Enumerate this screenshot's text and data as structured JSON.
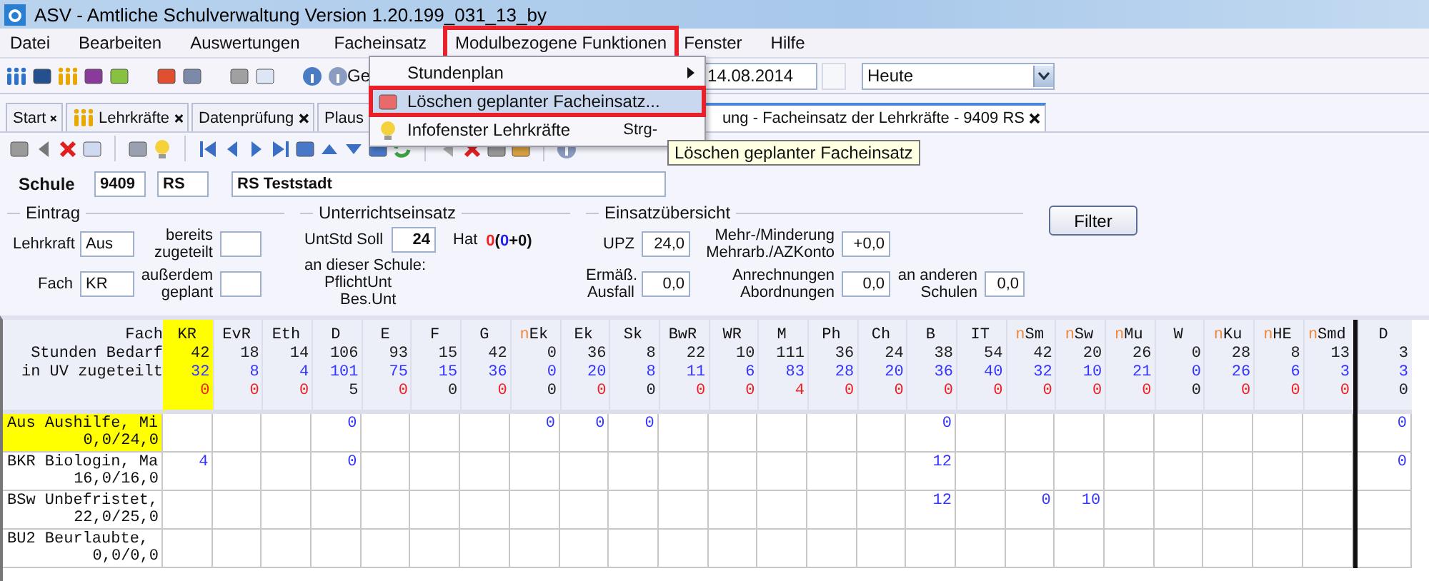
{
  "window": {
    "title": "ASV - Amtliche Schulverwaltung Version 1.20.199_031_13_by"
  },
  "menu_bar": [
    {
      "label": "Datei",
      "annotated": false
    },
    {
      "label": "Bearbeiten",
      "annotated": false
    },
    {
      "label": "Auswertungen",
      "annotated": false
    },
    {
      "label": "Facheinsatz",
      "annotated": false
    },
    {
      "label": "Modulbezogene Funktionen",
      "annotated": true
    },
    {
      "label": "Fenster",
      "annotated": false
    },
    {
      "label": "Hilfe",
      "annotated": false
    }
  ],
  "menu_dropdown": {
    "items": [
      {
        "label": "Stundenplan",
        "kind": "submenu",
        "selected": false,
        "annotated": false
      },
      {
        "label": "Löschen geplanter Facheinsatz...",
        "kind": "command",
        "selected": true,
        "annotated": true
      },
      {
        "label": "Infofenster Lehrkräfte",
        "kind": "command",
        "shortcut": "Strg-",
        "selected": false,
        "annotated": false
      }
    ]
  },
  "tooltip": "Löschen geplanter Facheinsatz",
  "toolbar": {
    "label": "Ge",
    "date": "14.08.2014",
    "period": "Heute"
  },
  "tabs": [
    {
      "label": "Start",
      "icon": false,
      "closable": true,
      "selected": false
    },
    {
      "label": "Lehrkräfte",
      "icon": true,
      "closable": true,
      "selected": false
    },
    {
      "label": "Datenprüfung",
      "icon": false,
      "closable": true,
      "selected": false
    },
    {
      "label": "Plaus",
      "icon": false,
      "selected": false
    },
    {
      "label": "ung - Facheinsatz der Lehrkräfte - 9409 RS",
      "icon": false,
      "closable": true,
      "selected": true
    }
  ],
  "school": {
    "label": "Schule",
    "number": "9409",
    "type": "RS",
    "name": "RS Teststadt"
  },
  "entry": {
    "title": "Eintrag",
    "teacher_label": "Lehrkraft",
    "teacher": "Aus",
    "subject_label": "Fach",
    "subject": "KR",
    "assigned_label": "bereits zugeteilt",
    "planned_label": "außerdem geplant"
  },
  "teaching": {
    "title": "Unterrichtseinsatz",
    "target_label": "UntStd Soll",
    "target": "24",
    "has_label": "Hat",
    "has_parts": [
      {
        "text": "0",
        "kind": "total"
      },
      {
        "text": "(",
        "kind": "plain"
      },
      {
        "text": "0",
        "kind": "here"
      },
      {
        "text": "+0)",
        "kind": "plain"
      }
    ],
    "school_label": "an dieser Schule:",
    "mandatory_label": "PflichtUnt",
    "special_label": "Bes.Unt"
  },
  "overview": {
    "title": "Einsatzübersicht",
    "upz_label": "UPZ",
    "upz": "24,0",
    "change_label": "Mehr-/Minderung Mehrarb./AZKonto",
    "change": "+0,0",
    "reduction_label": "Ermäß. Ausfall",
    "reduction": "0,0",
    "credit_label": "Anrechnungen Abordnungen",
    "credit": "0,0",
    "other_label": "an anderen Schulen",
    "other": "0,0"
  },
  "filter_button": "Filter",
  "table": {
    "row_header": {
      "line_1": "Fach",
      "line_2": "Stunden Bedarf",
      "line_3": "in UV zugeteilt"
    },
    "columns": [
      {
        "name": "KR",
        "need": "42",
        "assigned": "32",
        "difference": "0",
        "warning": true,
        "selected": true
      },
      {
        "name": "EvR",
        "need": "18",
        "assigned": "8",
        "difference": "0",
        "warning": true,
        "selected": false
      },
      {
        "name": "Eth",
        "need": "14",
        "assigned": "4",
        "difference": "0",
        "warning": true,
        "selected": false
      },
      {
        "name": "D",
        "need": "106",
        "assigned": "101",
        "difference": "5",
        "warning": false,
        "selected": false
      },
      {
        "name": "E",
        "need": "93",
        "assigned": "75",
        "difference": "0",
        "warning": true,
        "selected": false
      },
      {
        "name": "F",
        "need": "15",
        "assigned": "15",
        "difference": "0",
        "warning": false,
        "selected": false
      },
      {
        "name": "G",
        "need": "42",
        "assigned": "36",
        "difference": "0",
        "warning": true,
        "selected": false
      },
      {
        "prefix": "n",
        "name": "Ek",
        "need": "0",
        "assigned": "0",
        "difference": "0",
        "warning": false,
        "selected": false
      },
      {
        "name": "Ek",
        "need": "36",
        "assigned": "20",
        "difference": "0",
        "warning": true,
        "selected": false
      },
      {
        "name": "Sk",
        "need": "8",
        "assigned": "8",
        "difference": "0",
        "warning": false,
        "selected": false
      },
      {
        "name": "BwR",
        "need": "22",
        "assigned": "11",
        "difference": "0",
        "warning": true,
        "selected": false
      },
      {
        "name": "WR",
        "need": "10",
        "assigned": "6",
        "difference": "0",
        "warning": true,
        "selected": false
      },
      {
        "name": "M",
        "need": "111",
        "assigned": "83",
        "difference": "4",
        "warning": true,
        "selected": false
      },
      {
        "name": "Ph",
        "need": "36",
        "assigned": "28",
        "difference": "0",
        "warning": true,
        "selected": false
      },
      {
        "name": "Ch",
        "need": "24",
        "assigned": "20",
        "difference": "0",
        "warning": true,
        "selected": false
      },
      {
        "name": "B",
        "need": "38",
        "assigned": "36",
        "difference": "0",
        "warning": true,
        "selected": false
      },
      {
        "name": "IT",
        "need": "54",
        "assigned": "40",
        "difference": "0",
        "warning": true,
        "selected": false
      },
      {
        "prefix": "n",
        "name": "Sm",
        "need": "42",
        "assigned": "32",
        "difference": "0",
        "warning": true,
        "selected": false
      },
      {
        "prefix": "n",
        "name": "Sw",
        "need": "20",
        "assigned": "10",
        "difference": "0",
        "warning": true,
        "selected": false
      },
      {
        "prefix": "n",
        "name": "Mu",
        "need": "26",
        "assigned": "21",
        "difference": "0",
        "warning": true,
        "selected": false
      },
      {
        "name": "W",
        "need": "0",
        "assigned": "0",
        "difference": "0",
        "warning": false,
        "selected": false
      },
      {
        "prefix": "n",
        "name": "Ku",
        "need": "28",
        "assigned": "26",
        "difference": "0",
        "warning": true,
        "selected": false
      },
      {
        "prefix": "n",
        "name": "HE",
        "need": "8",
        "assigned": "6",
        "difference": "0",
        "warning": true,
        "selected": false
      },
      {
        "prefix": "n",
        "name": "Smd",
        "need": "13",
        "assigned": "3",
        "difference": "0",
        "warning": true,
        "selected": false
      },
      {
        "name": "D",
        "need": "3",
        "assigned": "3",
        "difference": "0",
        "warning": false,
        "selected": false
      }
    ],
    "rows": [
      {
        "name": "Aus Aushilfe, Mi",
        "hours": "0,0/24,0",
        "selected": true,
        "cells": [
          null,
          null,
          null,
          "0",
          null,
          null,
          null,
          "0",
          "0",
          "0",
          null,
          null,
          null,
          null,
          null,
          "0",
          null,
          null,
          null,
          null,
          null,
          null,
          null,
          null,
          "0"
        ]
      },
      {
        "name": "BKR Biologin, Ma",
        "hours": "16,0/16,0",
        "selected": false,
        "cells": [
          "4",
          null,
          null,
          "0",
          null,
          null,
          null,
          null,
          null,
          null,
          null,
          null,
          null,
          null,
          null,
          "12",
          null,
          null,
          null,
          null,
          null,
          null,
          null,
          null,
          "0"
        ]
      },
      {
        "name": "BSw Unbefristet,",
        "hours": "22,0/25,0",
        "selected": false,
        "cells": [
          null,
          null,
          null,
          null,
          null,
          null,
          null,
          null,
          null,
          null,
          null,
          null,
          null,
          null,
          null,
          "12",
          null,
          "0",
          "10",
          null,
          null,
          null,
          null,
          null,
          null
        ]
      },
      {
        "name": "BU2 Beurlaubte,",
        "hours": "0,0/0,0",
        "selected": false,
        "cells": [
          null,
          null,
          null,
          null,
          null,
          null,
          null,
          null,
          null,
          null,
          null,
          null,
          null,
          null,
          null,
          null,
          null,
          null,
          null,
          null,
          null,
          null,
          null,
          null,
          null
        ]
      }
    ]
  }
}
